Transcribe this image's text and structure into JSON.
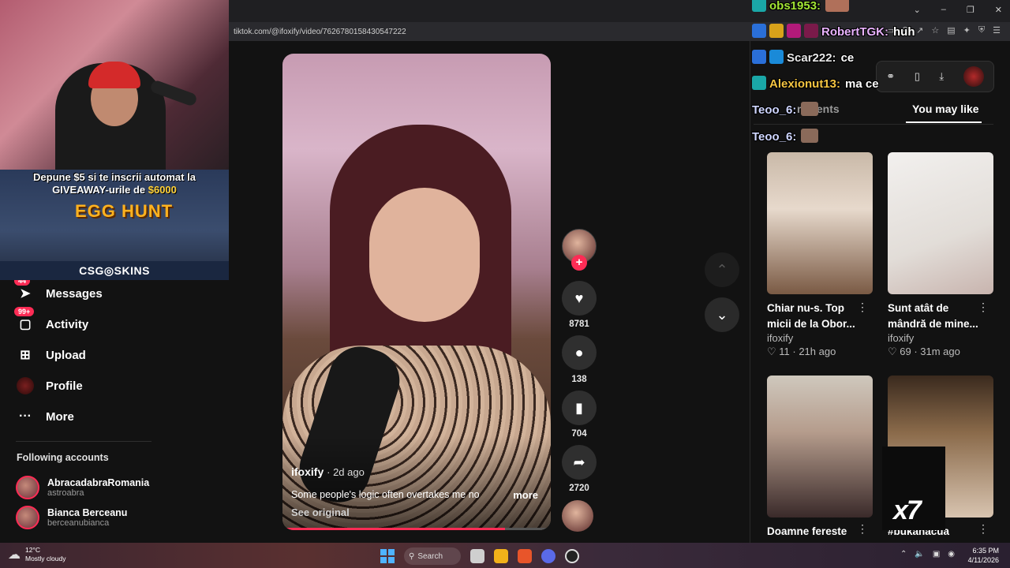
{
  "browser": {
    "url": "tiktok.com/@ifoxify/video/7626780158430547222"
  },
  "overlay": {
    "promo_line1": "Depune $5 si te inscrii automat la",
    "promo_line2a": "GIVEAWAY-urile de ",
    "promo_amount": "$6000",
    "promo_game": "EGG HUNT",
    "promo_brand": "CSG◎SKINS"
  },
  "nav": {
    "items": [
      {
        "label": "Messages",
        "badge": "44",
        "icon": "paper-plane-icon"
      },
      {
        "label": "Activity",
        "badge": "99+",
        "icon": "inbox-icon"
      },
      {
        "label": "Upload",
        "badge": "",
        "icon": "plus-square-icon"
      },
      {
        "label": "Profile",
        "badge": "",
        "icon": "avatar-icon"
      },
      {
        "label": "More",
        "badge": "",
        "icon": "more-dots-icon"
      }
    ],
    "following_heading": "Following accounts",
    "following": [
      {
        "name": "AbracadabraRomania",
        "handle": "astroabra"
      },
      {
        "name": "Bianca Berceanu",
        "handle": "berceanubianca"
      }
    ]
  },
  "video": {
    "author": "ifoxify",
    "age": "· 2d ago",
    "caption": "Some people's logic often overtakes me no",
    "more_label": "more",
    "see_original": "See original",
    "progress": 0.83,
    "likes": "8781",
    "comments": "138",
    "saves": "704",
    "shares": "2720"
  },
  "right": {
    "tab_comments": "mments",
    "tab_you_may_like": "You may like",
    "cards": [
      {
        "title": "Chiar nu-s. Top micii de la Obor...",
        "author": "ifoxify",
        "meta": "♡ 11 · 21h ago"
      },
      {
        "title": "Sunt atât de mândră de mine...",
        "author": "ifoxify",
        "meta": "♡ 69 · 31m ago"
      },
      {
        "title": "Doamne fereste",
        "author": "",
        "meta": ""
      },
      {
        "title": "#bukanacua",
        "author": "",
        "meta": ""
      }
    ]
  },
  "chat": [
    {
      "user": "obs1953:",
      "text": "",
      "color": "#a3e635"
    },
    {
      "user": "RobertTGK:",
      "text": "huh",
      "color": "#e9b3ff"
    },
    {
      "user": "Scar222:",
      "text": "ce",
      "color": "#e6e6e6"
    },
    {
      "user": "Alexionut13:",
      "text": "ma ce",
      "color": "#f5c542"
    },
    {
      "user": "Teoo_6:",
      "text": "",
      "color": "#cfd6ff"
    },
    {
      "user": "Teoo_6:",
      "text": "",
      "color": "#cfd6ff"
    }
  ],
  "stream_badge": "x7",
  "taskbar": {
    "temp": "12°C",
    "weather": "Mostly cloudy",
    "search": "Search",
    "time": "6:35 PM",
    "date": "4/11/2026"
  },
  "colors": {
    "accent": "#fe2c55",
    "background": "#121212"
  }
}
